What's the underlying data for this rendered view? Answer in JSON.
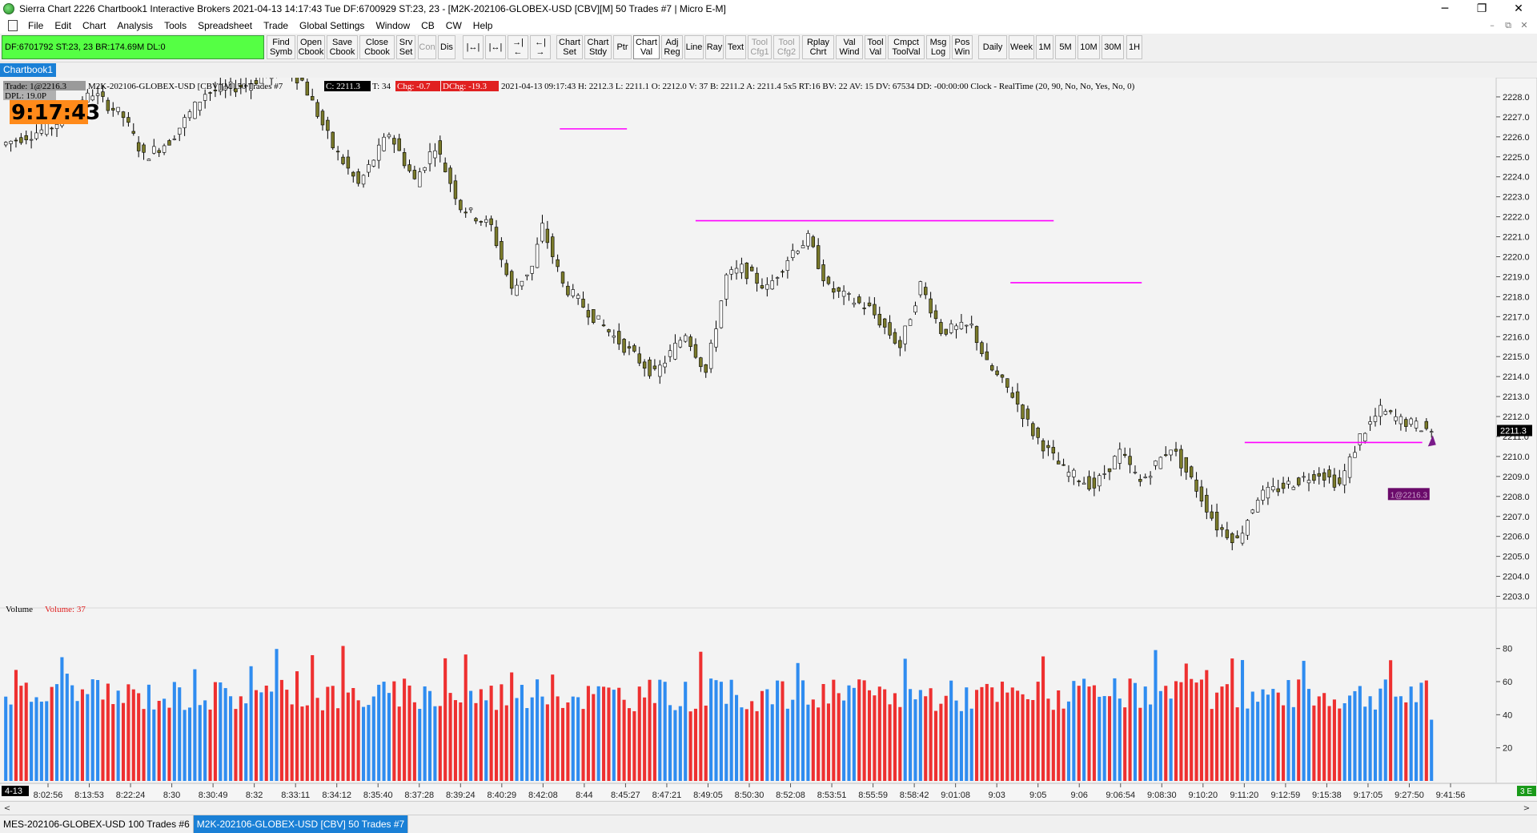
{
  "window": {
    "title": "Sierra Chart 2226 Chartbook1  Interactive Brokers 2021-04-13  14:17:43 Tue  DF:6700929  ST:23, 23  - [M2K-202106-GLOBEX-USD [CBV][M]  50 Trades  #7 | Micro E-M]",
    "controls": [
      "─",
      "❐",
      "✕"
    ]
  },
  "menu": [
    "File",
    "Edit",
    "Chart",
    "Analysis",
    "Tools",
    "Spreadsheet",
    "Trade",
    "Global Settings",
    "Window",
    "CB",
    "CW",
    "Help"
  ],
  "mdi_controls": [
    "–",
    "⧉",
    "✕"
  ],
  "status_box": "DF:6701792  ST:23, 23   BR:174.69M  DL:0",
  "toolbar": [
    {
      "label": "Find\nSymb",
      "state": "normal"
    },
    {
      "label": "Open\nCbook",
      "state": "normal"
    },
    {
      "label": "Save\nCbook",
      "state": "normal"
    },
    {
      "label": "Close\nCbook",
      "state": "normal"
    },
    {
      "label": "Srv\nSet",
      "state": "normal"
    },
    {
      "label": "Con",
      "state": "disabled"
    },
    {
      "label": "Dis",
      "state": "normal"
    },
    {
      "label": "|↔|",
      "state": "normal"
    },
    {
      "label": "|↔|",
      "state": "normal"
    },
    {
      "label": "→|←",
      "state": "normal"
    },
    {
      "label": "←|→",
      "state": "normal"
    },
    {
      "label": "Chart\nSet",
      "state": "normal"
    },
    {
      "label": "Chart\nStdy",
      "state": "normal"
    },
    {
      "label": "Ptr",
      "state": "normal"
    },
    {
      "label": "Chart\nVal",
      "state": "active"
    },
    {
      "label": "Adj\nReg",
      "state": "normal"
    },
    {
      "label": "Line",
      "state": "normal"
    },
    {
      "label": "Ray",
      "state": "normal"
    },
    {
      "label": "Text",
      "state": "normal"
    },
    {
      "label": "Tool\nCfg1",
      "state": "disabled"
    },
    {
      "label": "Tool\nCfg2",
      "state": "disabled"
    },
    {
      "label": "Rplay\nChrt",
      "state": "normal"
    },
    {
      "label": "Val\nWind",
      "state": "normal"
    },
    {
      "label": "Tool\nVal",
      "state": "normal"
    },
    {
      "label": "Cmpct\nToolVal",
      "state": "normal"
    },
    {
      "label": "Msg\nLog",
      "state": "normal"
    },
    {
      "label": "Pos\nWin",
      "state": "normal"
    },
    {
      "label": "Daily",
      "state": "normal"
    },
    {
      "label": "Week",
      "state": "normal"
    },
    {
      "label": "1M",
      "state": "normal"
    },
    {
      "label": "5M",
      "state": "normal"
    },
    {
      "label": "10M",
      "state": "normal"
    },
    {
      "label": "30M",
      "state": "normal"
    },
    {
      "label": "1H",
      "state": "normal"
    }
  ],
  "chartbook_tab": "Chartbook1",
  "header": {
    "trade": "Trade: 1@2216.3",
    "dpl": "DPL: 19.0P",
    "clock": "9:17:43",
    "symbol": "M2K-202106-GLOBEX-USD [CBV][M]  50 Trades  #7",
    "close": "C: 2211.3",
    "t": "T: 34",
    "chg": "Chg: -0.7",
    "dchg": "DChg: -19.3",
    "info": "2021-04-13 09:17:43 H: 2212.3 L: 2211.1 O: 2212.0 V: 37 B: 2211.2 A: 2211.4 5x5 RT:16 BV: 22 AV: 15 DV: 67534 DD: -00:00:00 Clock - RealTime  (20, 90, No, No, Yes, No, 0)"
  },
  "chart_data": {
    "type": "candlestick",
    "price_range": [
      2202.5,
      2228.8
    ],
    "price_ticks": [
      "2228.0",
      "2227.0",
      "2226.0",
      "2225.0",
      "2224.0",
      "2223.0",
      "2222.0",
      "2221.0",
      "2220.0",
      "2219.0",
      "2218.0",
      "2217.0",
      "2216.0",
      "2215.0",
      "2214.0",
      "2213.0",
      "2212.0",
      "2211.0",
      "2210.0",
      "2209.0",
      "2208.0",
      "2207.0",
      "2206.0",
      "2205.0",
      "2204.0",
      "2203.0"
    ],
    "last_price_label": "2211.3",
    "price_path": [
      [
        0,
        2225.6
      ],
      [
        10,
        2226.5
      ],
      [
        18,
        2228.2
      ],
      [
        24,
        2227.0
      ],
      [
        28,
        2225.0
      ],
      [
        33,
        2225.8
      ],
      [
        40,
        2228.2
      ],
      [
        48,
        2228.6
      ],
      [
        55,
        2229.5
      ],
      [
        59,
        2228.8
      ],
      [
        65,
        2225.5
      ],
      [
        70,
        2223.6
      ],
      [
        76,
        2226.2
      ],
      [
        81,
        2223.8
      ],
      [
        85,
        2225.6
      ],
      [
        90,
        2222.5
      ],
      [
        96,
        2221.5
      ],
      [
        100,
        2218.3
      ],
      [
        104,
        2219.5
      ],
      [
        106,
        2221.5
      ],
      [
        110,
        2218.6
      ],
      [
        116,
        2217.0
      ],
      [
        122,
        2215.5
      ],
      [
        128,
        2214.1
      ],
      [
        134,
        2216.2
      ],
      [
        138,
        2214.2
      ],
      [
        142,
        2219.0
      ],
      [
        145,
        2219.4
      ],
      [
        150,
        2218.4
      ],
      [
        155,
        2220.3
      ],
      [
        158,
        2220.9
      ],
      [
        162,
        2218.4
      ],
      [
        170,
        2217.4
      ],
      [
        176,
        2215.5
      ],
      [
        180,
        2218.6
      ],
      [
        184,
        2216.3
      ],
      [
        190,
        2216.5
      ],
      [
        193,
        2214.6
      ],
      [
        198,
        2213.1
      ],
      [
        202,
        2211.2
      ],
      [
        208,
        2209.3
      ],
      [
        214,
        2208.5
      ],
      [
        219,
        2210.2
      ],
      [
        223,
        2208.7
      ],
      [
        229,
        2210.5
      ],
      [
        234,
        2208.4
      ],
      [
        238,
        2206.5
      ],
      [
        242,
        2205.8
      ],
      [
        246,
        2208.0
      ],
      [
        252,
        2208.6
      ],
      [
        258,
        2209.2
      ],
      [
        262,
        2208.6
      ],
      [
        266,
        2211.0
      ],
      [
        270,
        2212.3
      ],
      [
        274,
        2211.8
      ],
      [
        280,
        2211.3
      ]
    ],
    "volume_ticks": [
      "80",
      "60",
      "40",
      "20"
    ],
    "volume_label": "Volume",
    "volume_value": "Volume: 37",
    "volume_range": [
      0,
      90
    ],
    "time_labels": [
      "8:02:56",
      "8:13:53",
      "8:22:24",
      "8:30",
      "8:30:49",
      "8:32",
      "8:33:11",
      "8:34:12",
      "8:35:40",
      "8:37:28",
      "8:39:24",
      "8:40:29",
      "8:42:08",
      "8:44",
      "8:45:27",
      "8:47:21",
      "8:49:05",
      "8:50:30",
      "8:52:08",
      "8:53:51",
      "8:55:59",
      "8:58:42",
      "9:01:08",
      "9:03",
      "9:05",
      "9:06",
      "9:06:54",
      "9:08:30",
      "9:10:20",
      "9:11:20",
      "9:12:59",
      "9:15:38",
      "9:17:05",
      "9:27:50",
      "9:41:56"
    ],
    "date_label": "4-13",
    "corner_label": "3 E",
    "levels": [
      {
        "price": 2226.4,
        "x_start": 0.373,
        "x_end": 0.418
      },
      {
        "price": 2221.8,
        "x_start": 0.464,
        "x_end": 0.704
      },
      {
        "price": 2218.7,
        "x_start": 0.675,
        "x_end": 0.763
      },
      {
        "price": 2210.7,
        "x_start": 0.832,
        "x_end": 0.951
      }
    ],
    "order_marker": {
      "price": 2208.1,
      "label": "1@2216.3"
    },
    "level_color": "#ff00ff",
    "up_color": "#2f8cf0",
    "down_color": "#ee3030",
    "candle_fill": "#7a7a2a"
  },
  "bottom_tabs": [
    {
      "label": "MES-202106-GLOBEX-USD  100 Trades  #6",
      "active": false
    },
    {
      "label": "M2K-202106-GLOBEX-USD [CBV]  50 Trades  #7",
      "active": true
    }
  ],
  "scroll": {
    "left": "<",
    "right": ">"
  }
}
